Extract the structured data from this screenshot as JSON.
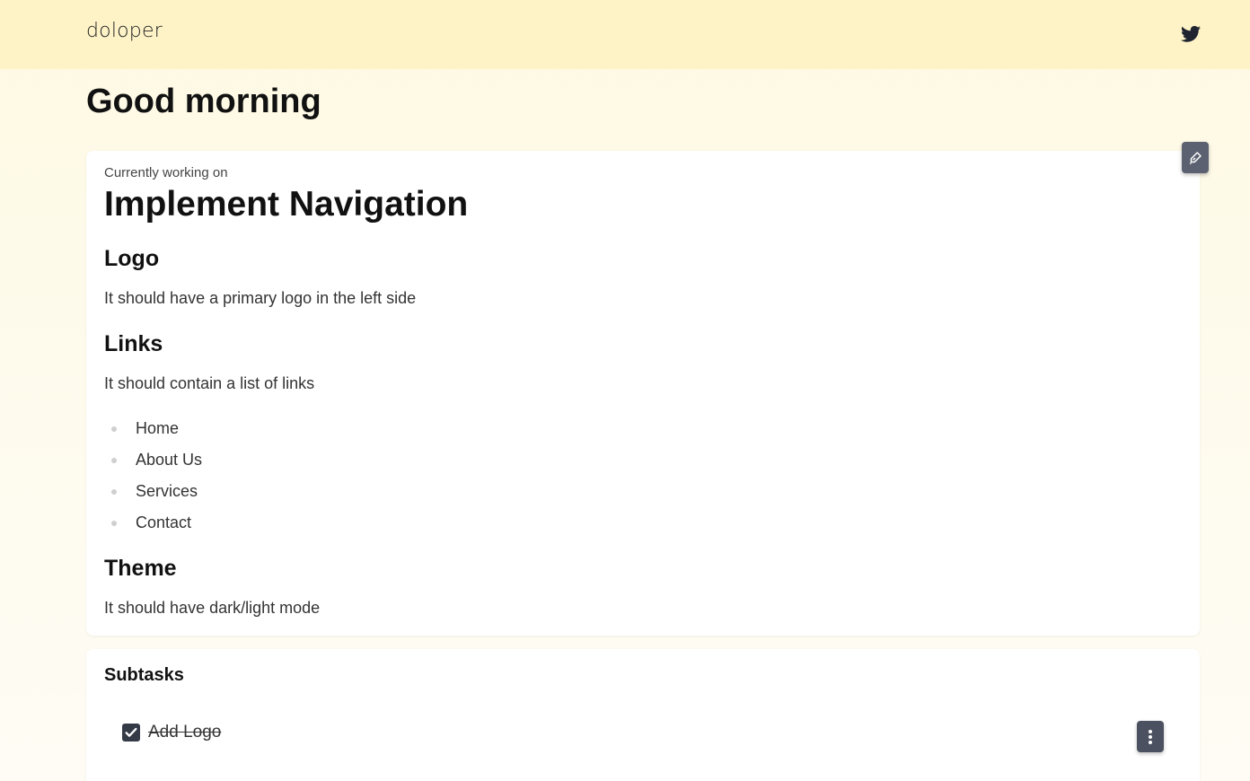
{
  "header": {
    "brand": "doloper",
    "social_icon": "twitter-icon",
    "background": "#fef3c7"
  },
  "greeting": "Good morning",
  "task": {
    "label": "Currently working on",
    "title": "Implement Navigation",
    "edit_icon": "pen-icon",
    "sections": {
      "logo": {
        "heading": "Logo",
        "text": "It should have a primary logo in the left side"
      },
      "links": {
        "heading": "Links",
        "text": "It should contain a list of links",
        "items": [
          "Home",
          "About Us",
          "Services",
          "Contact"
        ]
      },
      "theme": {
        "heading": "Theme",
        "text": "It should have dark/light mode"
      }
    }
  },
  "subtasks": {
    "title": "Subtasks",
    "items": [
      {
        "label": "Add Logo",
        "checked": true,
        "menu_icon": "kebab-icon"
      }
    ]
  },
  "colors": {
    "button_bg": "#5b6170",
    "checkbox_bg": "#343a46"
  }
}
